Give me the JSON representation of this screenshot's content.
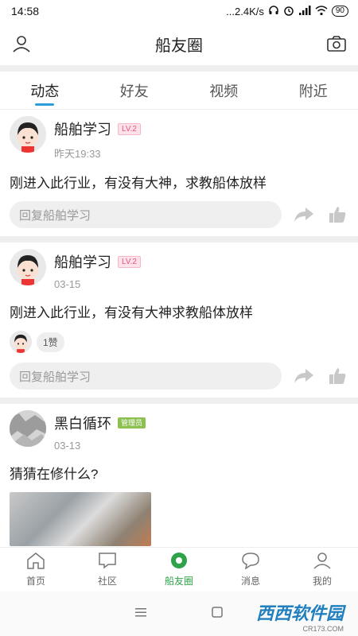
{
  "status_bar": {
    "time": "14:58",
    "network_speed": "...2.4K/s",
    "battery": "90"
  },
  "header": {
    "title": "船友圈"
  },
  "tabs": [
    {
      "label": "动态",
      "active": true
    },
    {
      "label": "好友",
      "active": false
    },
    {
      "label": "视频",
      "active": false
    },
    {
      "label": "附近",
      "active": false
    }
  ],
  "posts": [
    {
      "name": "船舶学习",
      "badge": "LV.2",
      "time": "昨天19:33",
      "content": "刚进入此行业，有没有大神，求教船体放样",
      "reply_placeholder": "回复船舶学习"
    },
    {
      "name": "船舶学习",
      "badge": "LV.2",
      "time": "03-15",
      "content": "刚进入此行业，有没有大神求教船体放样",
      "likes": "1赞",
      "reply_placeholder": "回复船舶学习"
    },
    {
      "name": "黑白循环",
      "badge": "管理员",
      "time": "03-13",
      "content": "猜猜在修什么?"
    }
  ],
  "bottom_nav": [
    {
      "label": "首页",
      "icon": "home-icon"
    },
    {
      "label": "社区",
      "icon": "community-icon"
    },
    {
      "label": "船友圈",
      "icon": "circle-icon",
      "active": true
    },
    {
      "label": "消息",
      "icon": "message-icon"
    },
    {
      "label": "我的",
      "icon": "profile-icon"
    }
  ],
  "watermark": {
    "text": "西西软件园",
    "sub": "CR173.COM"
  },
  "colors": {
    "accent_tab": "#2a9fd8",
    "nav_active": "#2fa24a",
    "level_badge": "#e6557a",
    "admin_badge": "#8cc152"
  }
}
